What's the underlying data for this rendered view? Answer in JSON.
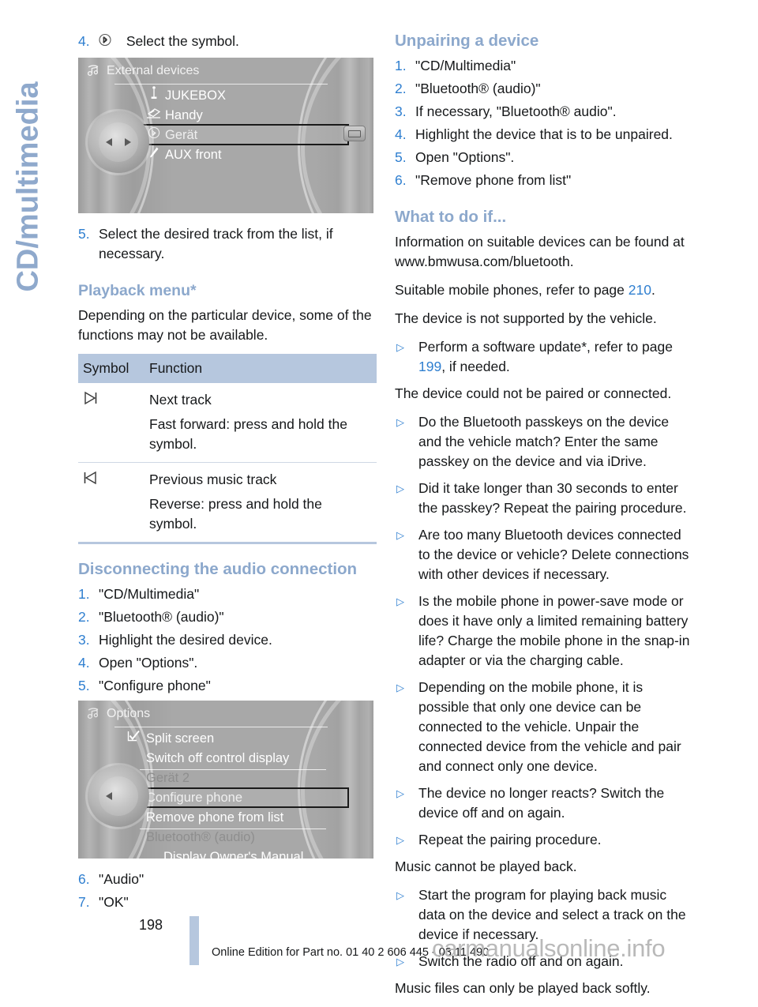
{
  "chapter_tab": {
    "label": "CD/multimedia"
  },
  "left_column": {
    "step4": {
      "num": "4.",
      "icon": "bluetooth-icon",
      "text": "Select the symbol."
    },
    "screenshot1": {
      "name": "external-devices-screen",
      "title": "External devices",
      "title_icon": "multimedia-icon",
      "items": [
        {
          "label": "JUKEBOX",
          "icon": "usb-icon",
          "checked": false
        },
        {
          "label": "Handy",
          "icon": "phone-icon",
          "checked": false
        },
        {
          "label": "Gerät",
          "icon": "bluetooth-icon",
          "checked": true,
          "selected": true
        },
        {
          "label": "AUX front",
          "icon": "aux-plug-icon",
          "checked": false
        }
      ]
    },
    "step5": {
      "num": "5.",
      "text": "Select the desired track from the list, if necessary."
    },
    "playback_heading": "Playback menu*",
    "playback_intro": "Depending on the particular device, some of the functions may not be available.",
    "table": {
      "headers": [
        "Symbol",
        "Function"
      ],
      "rows": [
        {
          "symbol_icon": "next-track-icon",
          "symbol_glyph": "▷|",
          "line1": "Next track",
          "line2": "Fast forward: press and hold the symbol."
        },
        {
          "symbol_icon": "previous-track-icon",
          "symbol_glyph": "|◁",
          "line1": "Previous music track",
          "line2": "Reverse: press and hold the symbol."
        }
      ]
    },
    "disconnect_heading": "Disconnecting the audio connection",
    "disconnect_steps": [
      {
        "num": "1.",
        "text": "\"CD/Multimedia\""
      },
      {
        "num": "2.",
        "text": "\"Bluetooth® (audio)\""
      },
      {
        "num": "3.",
        "text": "Highlight the desired device."
      },
      {
        "num": "4.",
        "text": "Open \"Options\"."
      },
      {
        "num": "5.",
        "text": "\"Configure phone\""
      }
    ],
    "screenshot2": {
      "name": "options-screen",
      "title": "Options",
      "title_icon": "multimedia-icon",
      "items": [
        {
          "label": "Split screen",
          "icon": "checkbox-checked-icon",
          "style": "normal"
        },
        {
          "label": "Switch off control display",
          "style": "normal"
        },
        {
          "label": "Gerät 2",
          "style": "group"
        },
        {
          "label": "Configure phone",
          "style": "normal",
          "selected": true
        },
        {
          "label": "Remove phone from list",
          "style": "normal"
        },
        {
          "label": "Bluetooth® (audio)",
          "style": "group"
        },
        {
          "label": "Display Owner's Manual",
          "style": "normal"
        }
      ]
    },
    "disconnect_steps_2": [
      {
        "num": "6.",
        "text": "\"Audio\""
      },
      {
        "num": "7.",
        "text": "\"OK\""
      }
    ]
  },
  "right_column": {
    "unpairing_heading": "Unpairing a device",
    "unpairing_steps": [
      {
        "num": "1.",
        "text": "\"CD/Multimedia\""
      },
      {
        "num": "2.",
        "text": "\"Bluetooth® (audio)\""
      },
      {
        "num": "3.",
        "text": "If necessary, \"Bluetooth® audio\"."
      },
      {
        "num": "4.",
        "text": "Highlight the device that is to be unpaired."
      },
      {
        "num": "5.",
        "text": "Open \"Options\"."
      },
      {
        "num": "6.",
        "text": "\"Remove phone from list\""
      }
    ],
    "what_to_do_heading": "What to do if...",
    "para1": "Information on suitable devices can be found at www.bmwusa.com/bluetooth.",
    "para2_pre": "Suitable mobile phones, refer to page ",
    "para2_ref": "210",
    "para2_post": ".",
    "para3": "The device is not supported by the vehicle.",
    "bullet1_pre": "Perform a software update*, refer to page ",
    "bullet1_ref": "199",
    "bullet1_post": ", if needed.",
    "para4": "The device could not be paired or connected.",
    "bullets_a": [
      "Do the Bluetooth passkeys on the device and the vehicle match? Enter the same passkey on the device and via iDrive.",
      "Did it take longer than 30 seconds to enter the passkey? Repeat the pairing procedure.",
      "Are too many Bluetooth devices connected to the device or vehicle? Delete connections with other devices if necessary.",
      "Is the mobile phone in power-save mode or does it have only a limited remaining battery life? Charge the mobile phone in the snap-in adapter or via the charging cable.",
      "Depending on the mobile phone, it is possible that only one device can be connected to the vehicle. Unpair the connected device from the vehicle and pair and connect only one device.",
      "The device no longer reacts? Switch the device off and on again.",
      "Repeat the pairing procedure."
    ],
    "para5": "Music cannot be played back.",
    "bullets_b": [
      "Start the program for playing back music data on the device and select a track on the device if necessary.",
      "Switch the radio off and on again."
    ],
    "para6": "Music files can only be played back softly."
  },
  "footer": {
    "page_number": "198",
    "edition_text": "Online Edition for Part no. 01 40 2 606 445 - 03 11 490",
    "watermark": "carmanualsonline.info"
  },
  "colors": {
    "heading_blue": "#8ca8cc",
    "link_blue": "#2f7fd0",
    "table_header_bg": "#b6c7de",
    "tab_blue": "#8fa9cc"
  }
}
